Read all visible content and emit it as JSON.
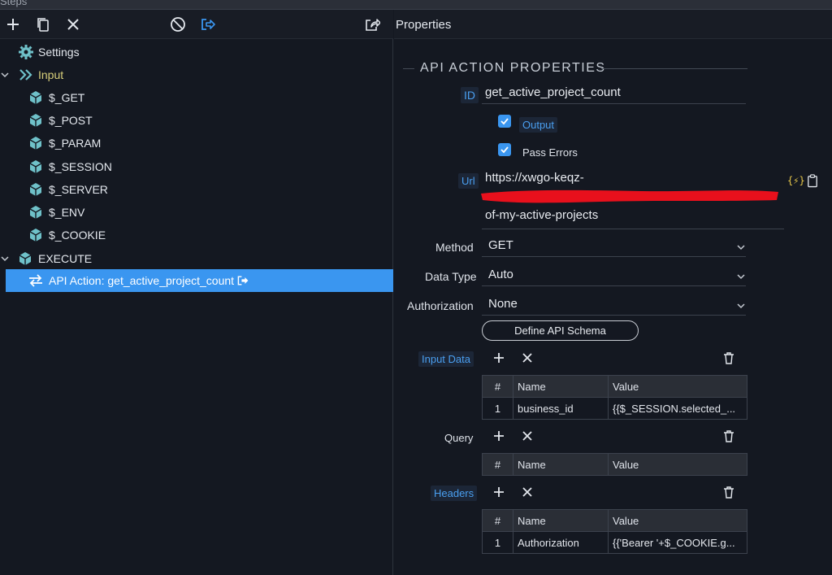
{
  "window": {
    "title": "Steps"
  },
  "steps_toolbar": {
    "icons": [
      "plus-icon",
      "copy-icon",
      "close-icon",
      "disable-icon",
      "output-icon"
    ]
  },
  "tree": {
    "settings": "Settings",
    "input": "Input",
    "input_children": [
      "$_GET",
      "$_POST",
      "$_PARAM",
      "$_SESSION",
      "$_SERVER",
      "$_ENV",
      "$_COOKIE"
    ],
    "execute": "EXECUTE",
    "selected_step": "API Action: get_active_project_count"
  },
  "properties": {
    "header": "Properties",
    "section": "API ACTION PROPERTIES",
    "id_label": "ID",
    "id_value": "get_active_project_count",
    "output_label": "Output",
    "output_checked": true,
    "pass_errors_label": "Pass Errors",
    "pass_errors_checked": true,
    "url_label": "Url",
    "url_line1": "https://xwgo-keqz-",
    "url_line3": "of-my-active-projects",
    "method_label": "Method",
    "method_value": "GET",
    "datatype_label": "Data Type",
    "datatype_value": "Auto",
    "auth_label": "Authorization",
    "auth_value": "None",
    "schema_button": "Define API Schema",
    "input_data_label": "Input Data",
    "query_label": "Query",
    "headers_label": "Headers",
    "col_idx": "#",
    "col_name": "Name",
    "col_value": "Value",
    "input_rows": [
      {
        "idx": "1",
        "name": "business_id",
        "value": "{{$_SESSION.selected_..."
      }
    ],
    "header_rows": [
      {
        "idx": "1",
        "name": "Authorization",
        "value": "{{'Bearer '+$_COOKIE.g..."
      }
    ]
  },
  "colors": {
    "accent": "#3a96f0",
    "teal_icon": "#6fc1c9",
    "input_label": "#d8cf7a"
  }
}
